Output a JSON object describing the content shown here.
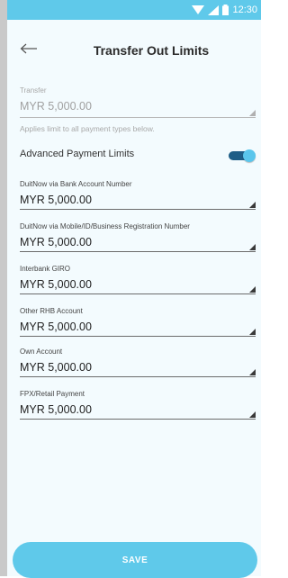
{
  "status_bar": {
    "time": "12:30"
  },
  "header": {
    "title": "Transfer Out Limits"
  },
  "transfer": {
    "label": "Transfer",
    "value": "MYR 5,000.00",
    "helper": "Applies limit to all payment types below."
  },
  "advanced": {
    "label": "Advanced Payment Limits",
    "enabled": true
  },
  "limits": [
    {
      "label": "DuitNow via Bank Account Number",
      "value": "MYR 5,000.00"
    },
    {
      "label": "DuitNow via Mobile/ID/Business Registration Number",
      "value": "MYR 5,000.00"
    },
    {
      "label": "Interbank GIRO",
      "value": "MYR 5,000.00"
    },
    {
      "label": "Other RHB Account",
      "value": "MYR 5,000.00"
    },
    {
      "label": "Own Account",
      "value": "MYR 5,000.00"
    },
    {
      "label": "FPX/Retail Payment",
      "value": "MYR 5,000.00"
    }
  ],
  "footer": {
    "save_label": "SAVE"
  },
  "colors": {
    "accent": "#5fc9ea",
    "toggle_track": "#1e5e87",
    "background": "#f3fbfe"
  }
}
